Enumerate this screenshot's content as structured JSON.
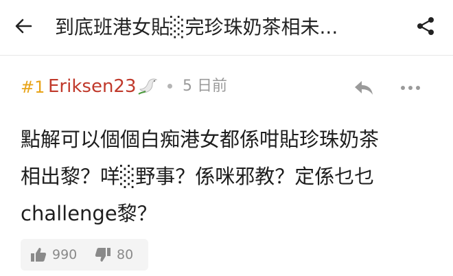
{
  "header": {
    "title": "到底班港女貼░完珍珠奶茶相未...",
    "back_icon": "arrow-left-icon",
    "share_icon": "share-icon"
  },
  "post": {
    "floor": "#1",
    "username": "Eriksen23",
    "badge_icon": "dove-icon",
    "time": "5 日前",
    "reply_icon": "reply-icon",
    "more_icon": "more-dots-icon",
    "lines": [
      "點解可以個個白痴港女都係咁貼珍珠奶茶",
      "相出黎？咩░野事？係咪邪教？定係乜乜",
      "challenge黎？"
    ],
    "upvotes": "990",
    "downvotes": "80"
  },
  "colors": {
    "floor": "#e8a317",
    "username": "#c0392b",
    "meta_gray": "#9a9a9a",
    "vote_bg": "#f4f4f4"
  }
}
